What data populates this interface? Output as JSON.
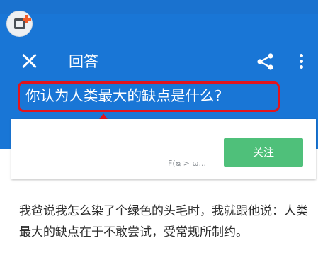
{
  "appbar": {
    "title": "回答",
    "close_icon": "close-icon",
    "share_icon": "share-icon",
    "more_icon": "more-vertical-icon",
    "color": "#1976d6"
  },
  "question": {
    "text": "你认为人类最大的缺点是什么?",
    "highlight_color": "#e2141d"
  },
  "author_card": {
    "author_name": "F(ᴓ > ω...",
    "follow_label": "关注",
    "follow_color": "#4fc07a"
  },
  "answer": {
    "text": "我爸说我怎么染了个绿色的头毛时，我就跟他说：人类最大的缺点在于不敢尝试，受常规所制约。"
  }
}
